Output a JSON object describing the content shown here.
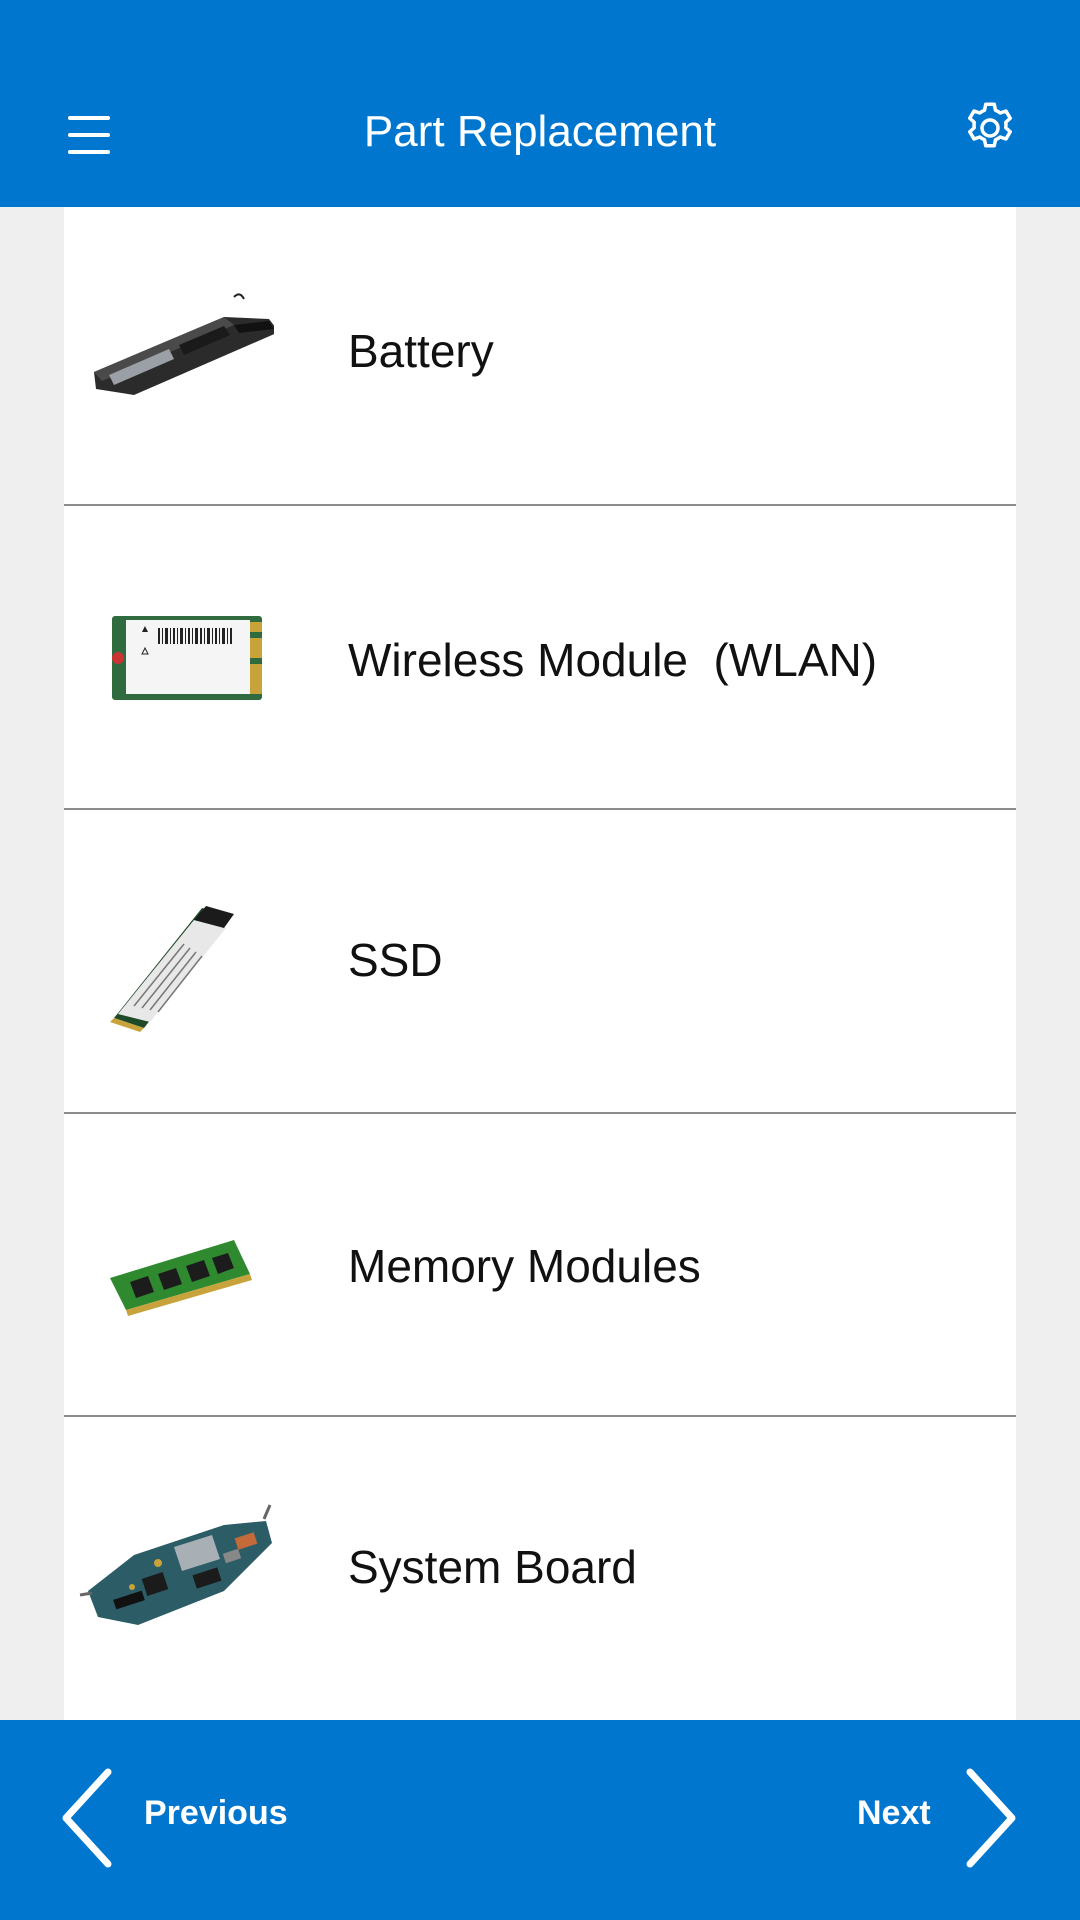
{
  "header": {
    "title": "Part Replacement",
    "menu_icon": "hamburger-menu-icon",
    "settings_icon": "gear-icon"
  },
  "parts": [
    {
      "label": "Battery",
      "icon": "battery-icon"
    },
    {
      "label": "Wireless Module  (WLAN)",
      "icon": "wlan-card-icon"
    },
    {
      "label": "SSD",
      "icon": "ssd-icon"
    },
    {
      "label": "Memory Modules",
      "icon": "memory-module-icon"
    },
    {
      "label": "System Board",
      "icon": "system-board-icon"
    }
  ],
  "footer": {
    "previous_label": "Previous",
    "next_label": "Next",
    "previous_icon": "chevron-left-icon",
    "next_icon": "chevron-right-icon"
  },
  "colors": {
    "brand_blue": "#0076ce",
    "background": "#efefef",
    "card": "#ffffff",
    "divider": "#8c8c8c"
  }
}
